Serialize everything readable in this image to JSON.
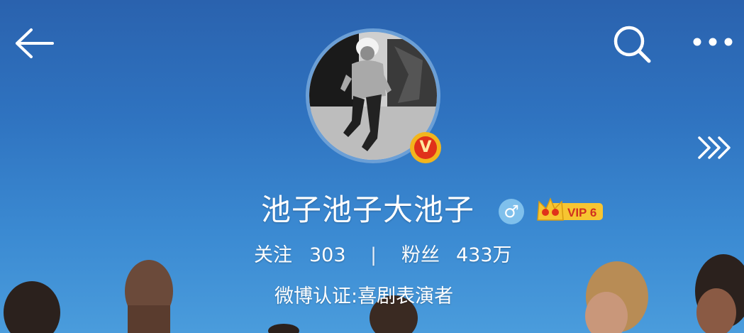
{
  "profile": {
    "username": "池子池子大池子",
    "gender_symbol": "♂",
    "avatar_badge": "V",
    "vip_label": "VIP 6",
    "stats": {
      "following_label": "关注",
      "following_count": "303",
      "divider": "|",
      "fans_label": "粉丝",
      "fans_count": "433万"
    },
    "verification": "微博认证:喜剧表演者"
  },
  "icons": {
    "back": "back-arrow-icon",
    "search": "search-icon",
    "more": "more-dots-icon",
    "forward": "triple-chevron-right-icon"
  },
  "colors": {
    "sky_top": "#2a62ae",
    "sky_bottom": "#4a9cdc",
    "vip_gold": "#f7c531",
    "verified_red": "#e0311a",
    "gender_blue": "#7fc0ec"
  }
}
